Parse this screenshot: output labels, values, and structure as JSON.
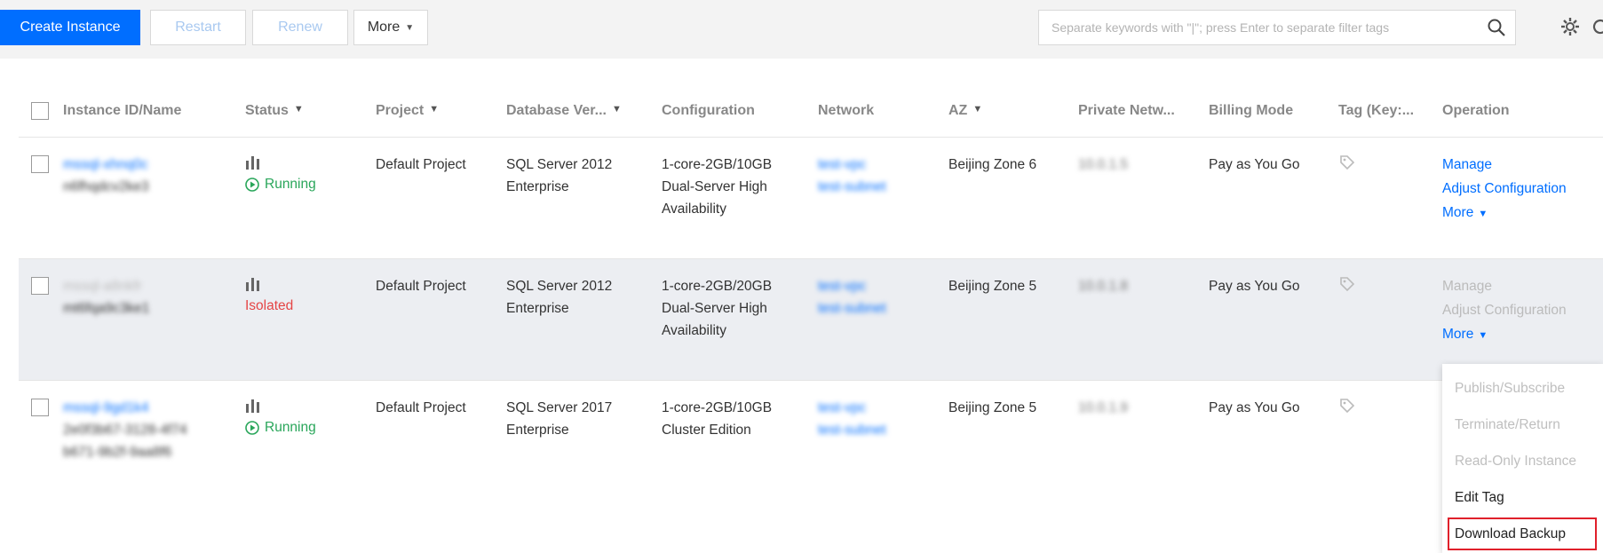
{
  "toolbar": {
    "create_label": "Create Instance",
    "restart_label": "Restart",
    "renew_label": "Renew",
    "more_label": "More",
    "search_placeholder": "Separate keywords with \"|\"; press Enter to separate filter tags"
  },
  "columns": {
    "instance": "Instance ID/Name",
    "status": "Status",
    "project": "Project",
    "db_version": "Database Ver...",
    "config": "Configuration",
    "network": "Network",
    "az": "AZ",
    "private_net": "Private Netw...",
    "billing": "Billing Mode",
    "tag": "Tag (Key:...",
    "operation": "Operation"
  },
  "rows": [
    {
      "id": "mssql-xhnq0c",
      "name": "n6fhqdcv2ke3",
      "status": "Running",
      "project": "Default Project",
      "db1": "SQL Server 2012",
      "db2": "Enterprise",
      "cfg1": "1-core-2GB/10GB",
      "cfg2": "Dual-Server High",
      "cfg3": "Availability",
      "net1": "test-vpc",
      "net2": "test-subnet",
      "az": "Beijing Zone 6",
      "private_ip": "10.0.1.5",
      "billing": "Pay as You Go",
      "manage": "Manage",
      "adjust": "Adjust Configuration",
      "more": "More"
    },
    {
      "id": "mssql-a8nkfr",
      "name": "mt6fqa9c3ke1",
      "status": "Isolated",
      "project": "Default Project",
      "db1": "SQL Server 2012",
      "db2": "Enterprise",
      "cfg1": "1-core-2GB/20GB",
      "cfg2": "Dual-Server High",
      "cfg3": "Availability",
      "net1": "test-vpc",
      "net2": "test-subnet",
      "az": "Beijing Zone 5",
      "private_ip": "10.0.1.8",
      "billing": "Pay as You Go",
      "manage": "Manage",
      "adjust": "Adjust Configuration",
      "more": "More"
    },
    {
      "id": "mssql-9gd1k4",
      "name1": "2e0f3b67-3128-4f74",
      "name2": "b671-9b2f-9aa8f6",
      "status": "Running",
      "project": "Default Project",
      "db1": "SQL Server 2017",
      "db2": "Enterprise",
      "cfg1": "1-core-2GB/10GB",
      "cfg2": "Cluster Edition",
      "net1": "test-vpc",
      "net2": "test-subnet",
      "az": "Beijing Zone 5",
      "private_ip": "10.0.1.9",
      "billing": "Pay as You Go"
    }
  ],
  "dropdown": {
    "items": [
      "Publish/Subscribe",
      "Terminate/Return",
      "Read-Only Instance",
      "Edit Tag",
      "Download Backup"
    ]
  },
  "colors": {
    "primary": "#006eff",
    "running": "#29a65a",
    "isolated": "#e54545",
    "highlight_box": "#e0202b"
  },
  "icons": [
    "search-icon",
    "gear-icon",
    "refresh-icon",
    "filter-icon",
    "bar-chart-icon",
    "play-circle-icon",
    "tag-icon",
    "caret-down-icon"
  ]
}
